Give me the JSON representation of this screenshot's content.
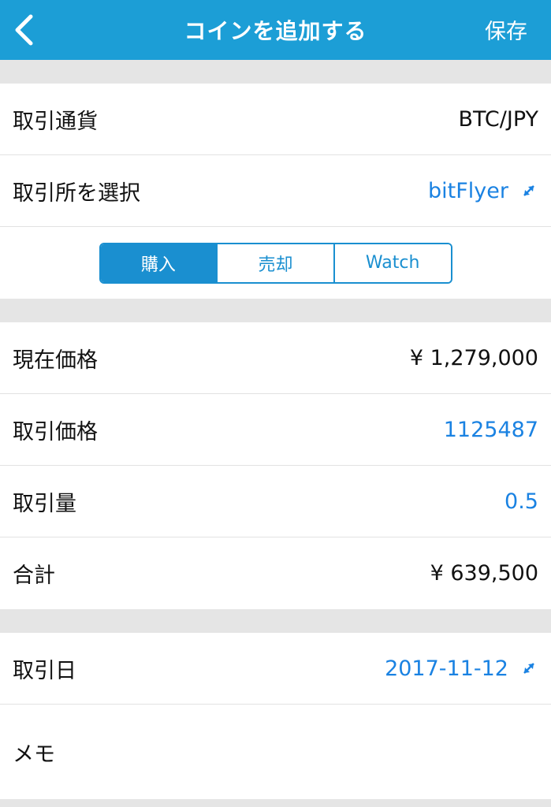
{
  "navbar": {
    "title": "コインを追加する",
    "save_label": "保存",
    "bg_color": "#1c9ed6"
  },
  "pair": {
    "label": "取引通貨",
    "value": "BTC/JPY"
  },
  "exchange": {
    "label": "取引所を選択",
    "value": "bitFlyer"
  },
  "segments": [
    {
      "label": "購入",
      "active": true
    },
    {
      "label": "売却",
      "active": false
    },
    {
      "label": "Watch",
      "active": false
    }
  ],
  "price_section": {
    "current_price": {
      "label": "現在価格",
      "value": "¥ 1,279,000"
    },
    "trade_price": {
      "label": "取引価格",
      "value": "1125487"
    },
    "trade_amount": {
      "label": "取引量",
      "value": "0.5"
    },
    "total": {
      "label": "合計",
      "value": "¥ 639,500"
    }
  },
  "date_section": {
    "trade_date": {
      "label": "取引日",
      "value": "2017-11-12"
    },
    "memo": {
      "label": "メモ",
      "value": ""
    }
  },
  "colors": {
    "accent": "#1a82e2",
    "segment": "#1a8fd0",
    "background": "#e5e5e5"
  }
}
